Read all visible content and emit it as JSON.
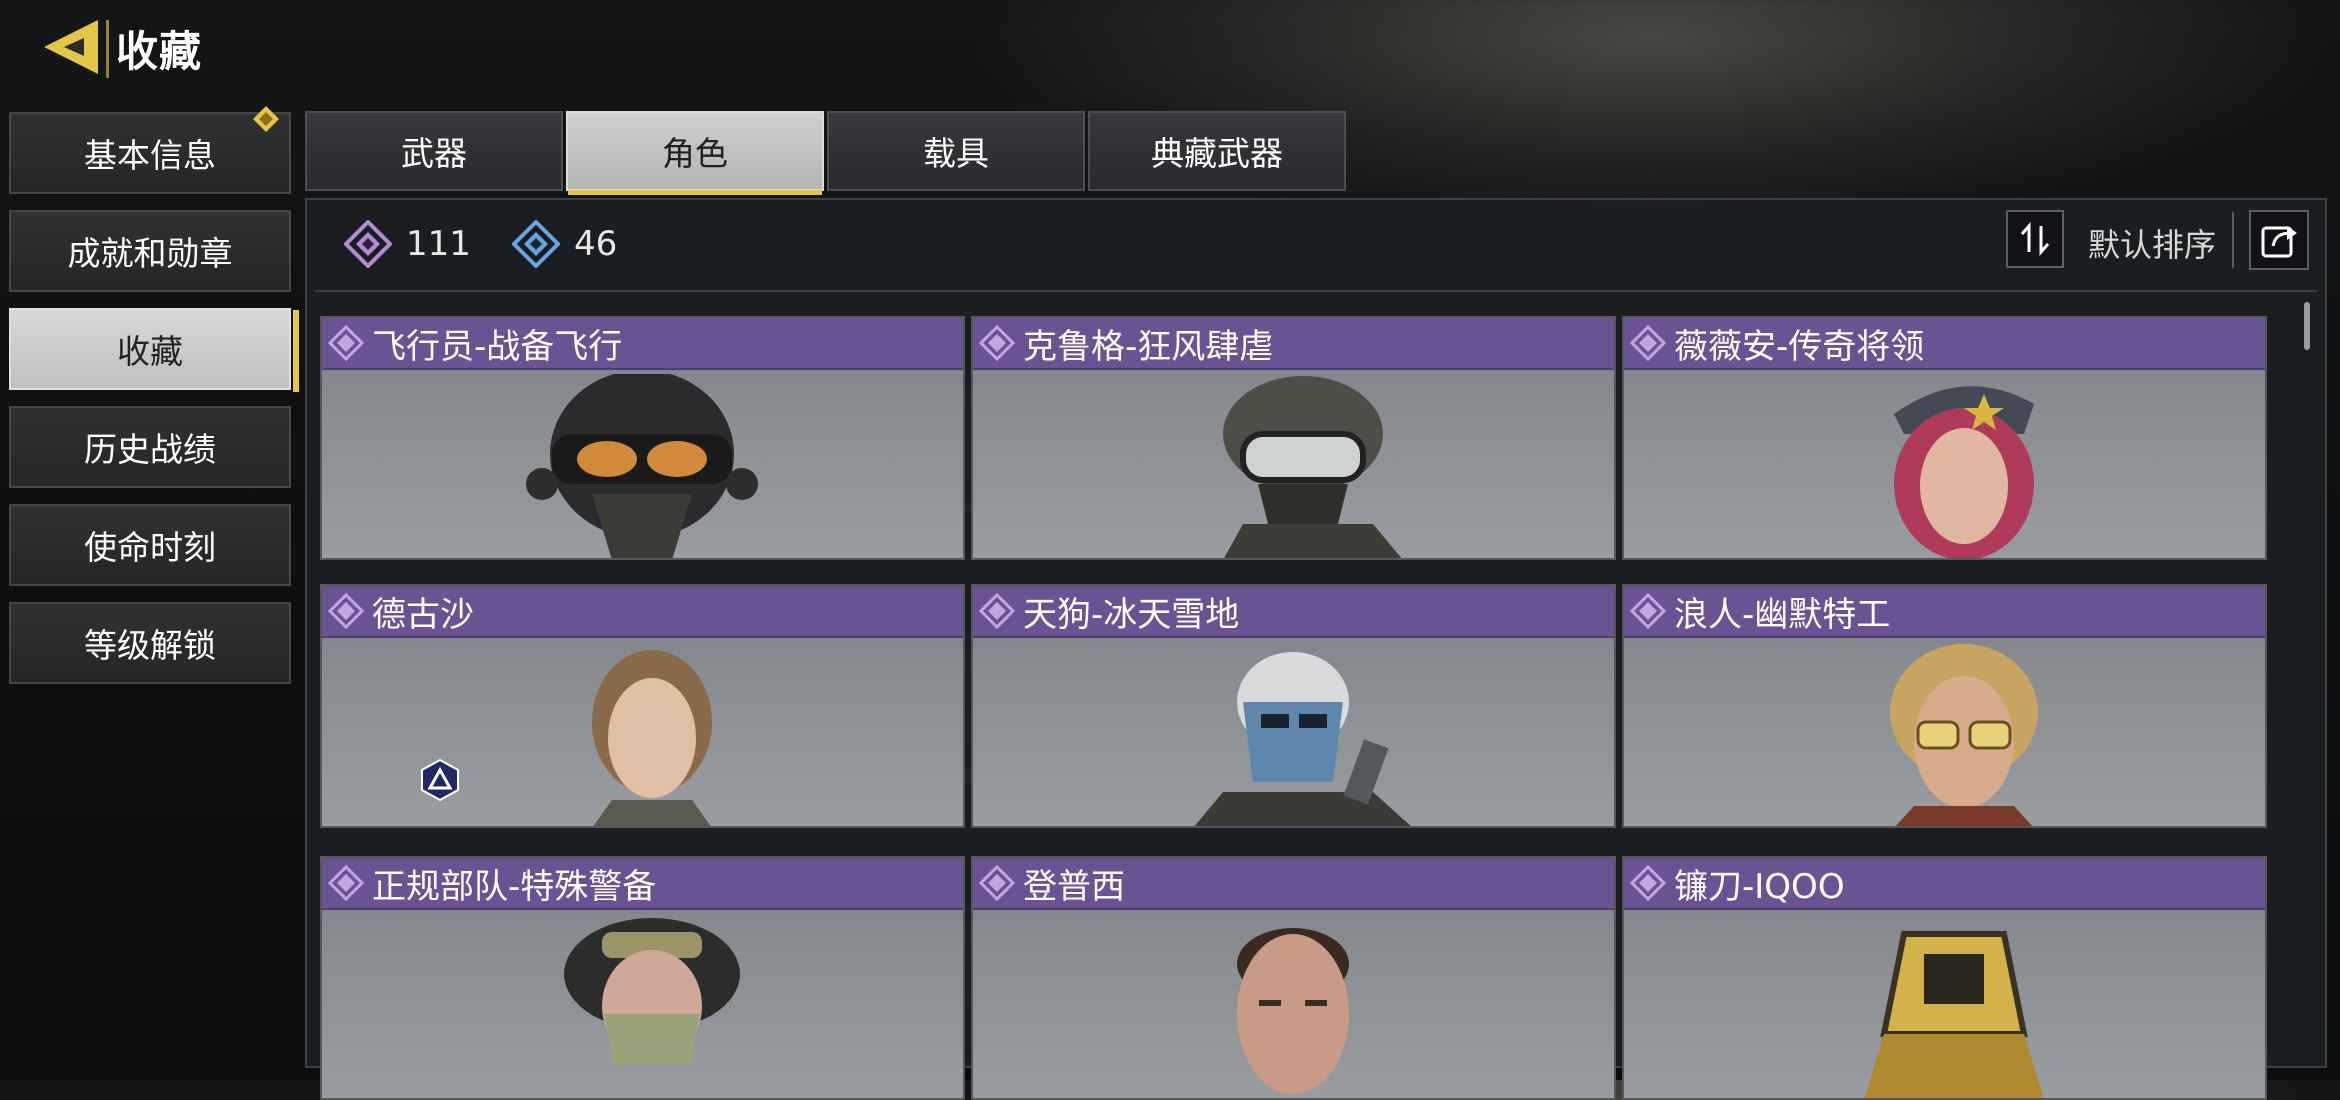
{
  "header": {
    "title": "收藏"
  },
  "sidebar": {
    "items": [
      {
        "label": "基本信息"
      },
      {
        "label": "成就和勋章"
      },
      {
        "label": "收藏"
      },
      {
        "label": "历史战绩"
      },
      {
        "label": "使命时刻"
      },
      {
        "label": "等级解锁"
      }
    ],
    "active_index": 2
  },
  "tabs": [
    {
      "label": "武器"
    },
    {
      "label": "角色"
    },
    {
      "label": "载具"
    },
    {
      "label": "典藏武器"
    }
  ],
  "active_tab": 1,
  "currency": [
    {
      "icon": "purple-diamond-icon",
      "value": "111"
    },
    {
      "icon": "blue-diamond-icon",
      "value": "46"
    }
  ],
  "sort": {
    "label": "默认排序"
  },
  "cards": [
    {
      "name": "飞行员-战备飞行"
    },
    {
      "name": "克鲁格-狂风肆虐"
    },
    {
      "name": "薇薇安-传奇将领"
    },
    {
      "name": "德古沙"
    },
    {
      "name": "天狗-冰天雪地"
    },
    {
      "name": "浪人-幽默特工"
    },
    {
      "name": "正规部队-特殊警备"
    },
    {
      "name": "登普西"
    },
    {
      "name": "镰刀-IQOO"
    }
  ],
  "colors": {
    "accent": "#e4c64a",
    "card_header": "#6a5392",
    "purple_gem": "#b48ad8",
    "blue_gem": "#6aa4e0"
  }
}
